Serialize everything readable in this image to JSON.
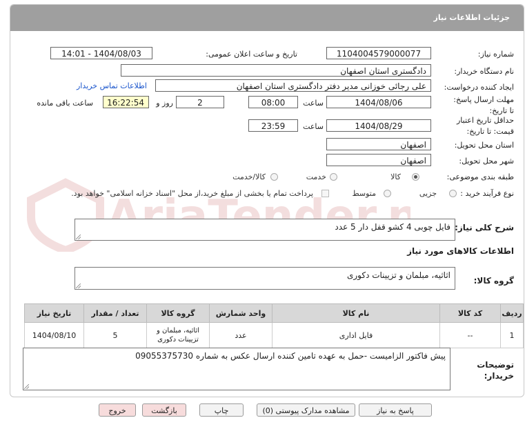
{
  "header": {
    "title": "جزئیات اطلاعات نیاز"
  },
  "fields": {
    "need_number_label": "شماره نیاز:",
    "need_number": "1104004579000077",
    "announce_label": "تاریخ و ساعت اعلان عمومی:",
    "announce_value": "1404/08/03 - 14:01",
    "buyer_label": "نام دستگاه خریدار:",
    "buyer": "دادگستری استان اصفهان",
    "creator_label": "ایجاد کننده درخواست:",
    "creator": "علی رجائی خوزانی مدیر دفتر دادگستری استان اصفهان",
    "contact_link": "اطلاعات تماس خریدار",
    "reply_deadline_label": "مهلت ارسال پاسخ: تا تاریخ:",
    "reply_date": "1404/08/06",
    "time_label": "ساعت",
    "reply_time": "08:00",
    "days": "2",
    "days_label": "روز و",
    "remaining_time": "16:22:54",
    "remaining_label": "ساعت باقی مانده",
    "validity_label": "حداقل تاریخ اعتبار قیمت: تا تاریخ:",
    "validity_date": "1404/08/29",
    "validity_time": "23:59",
    "province_label": "استان محل تحویل:",
    "province": "اصفهان",
    "city_label": "شهر محل تحویل:",
    "city": "اصفهان",
    "category_label": "طبقه بندی موضوعی:",
    "category_options": [
      "کالا",
      "خدمت",
      "کالا/خدمت"
    ],
    "process_label": "نوع فرآیند خرید :",
    "process_options": [
      "جزیی",
      "متوسط"
    ],
    "payment_note": "پرداخت تمام یا بخشی از مبلغ خرید،از محل \"اسناد خزانه اسلامی\" خواهد بود."
  },
  "description": {
    "label": "شرح کلی نیاز:",
    "text": "فایل چوبی 4 کشو قفل دار 5 عدد"
  },
  "goods_section": {
    "title": "اطلاعات کالاهای مورد نیاز"
  },
  "goods_group": {
    "label": "گروه کالا:",
    "value": "اثاثیه، مبلمان و تزیینات دکوری"
  },
  "table": {
    "headers": [
      "ردیف",
      "کد کالا",
      "نام کالا",
      "واحد شمارش",
      "گروه کالا",
      "تعداد / مقدار",
      "تاریخ نیاز"
    ],
    "rows": [
      [
        "1",
        "--",
        "فایل اداری",
        "عدد",
        "اثاثیه، مبلمان و تزیینات دکوری",
        "5",
        "1404/08/10"
      ]
    ]
  },
  "buyer_notes": {
    "label": "توضیحات خریدار:",
    "text": "پیش فاکتور الزامیست -حمل به عهده تامین کننده ارسال عکس به شماره 09055375730"
  },
  "buttons": {
    "reply": "پاسخ به نیاز",
    "attachments": "مشاهده مدارک پیوستی (0)",
    "print": "چاپ",
    "back": "بازگشت",
    "exit": "خروج"
  },
  "watermark": {
    "text": "AriaTender.neT"
  },
  "colors": {
    "header": "#9f9f9f",
    "link": "#1a55cc",
    "time_box": "#ffffcc",
    "table_header": "#d8d8d8",
    "watermark": "#f3dede"
  }
}
